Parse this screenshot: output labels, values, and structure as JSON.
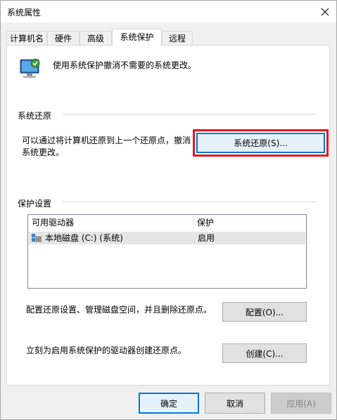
{
  "window": {
    "title": "系统属性"
  },
  "tabs": [
    {
      "label": "计算机名"
    },
    {
      "label": "硬件"
    },
    {
      "label": "高级"
    },
    {
      "label": "系统保护",
      "active": true
    },
    {
      "label": "远程"
    }
  ],
  "header": {
    "description": "使用系统保护撤消不需要的系统更改。",
    "icon": "system-protection-monitor-icon"
  },
  "restore": {
    "section_title": "系统还原",
    "description_line1": "可以通过将计算机还原到上一个还原点，撤消",
    "description_line2": "系统更改。",
    "button_label": "系统还原(S)..."
  },
  "protection": {
    "section_title": "保护设置",
    "columns": [
      "可用驱动器",
      "保护"
    ],
    "drives": [
      {
        "name": "本地磁盘 (C:) (系统)",
        "status": "启用",
        "icon": "drive-icon"
      }
    ],
    "configure_text": "配置还原设置、管理磁盘空间，并且删除还原点。",
    "configure_label": "配置(O)...",
    "create_text": "立刻为启用系统保护的驱动器创建还原点。",
    "create_label": "创建(C)..."
  },
  "footer": {
    "ok_label": "确定",
    "cancel_label": "取消",
    "apply_label": "应用(A)"
  },
  "colors": {
    "highlight": "#e8161d",
    "accent": "#0078d7",
    "selected_row": "#e5e5e5"
  }
}
